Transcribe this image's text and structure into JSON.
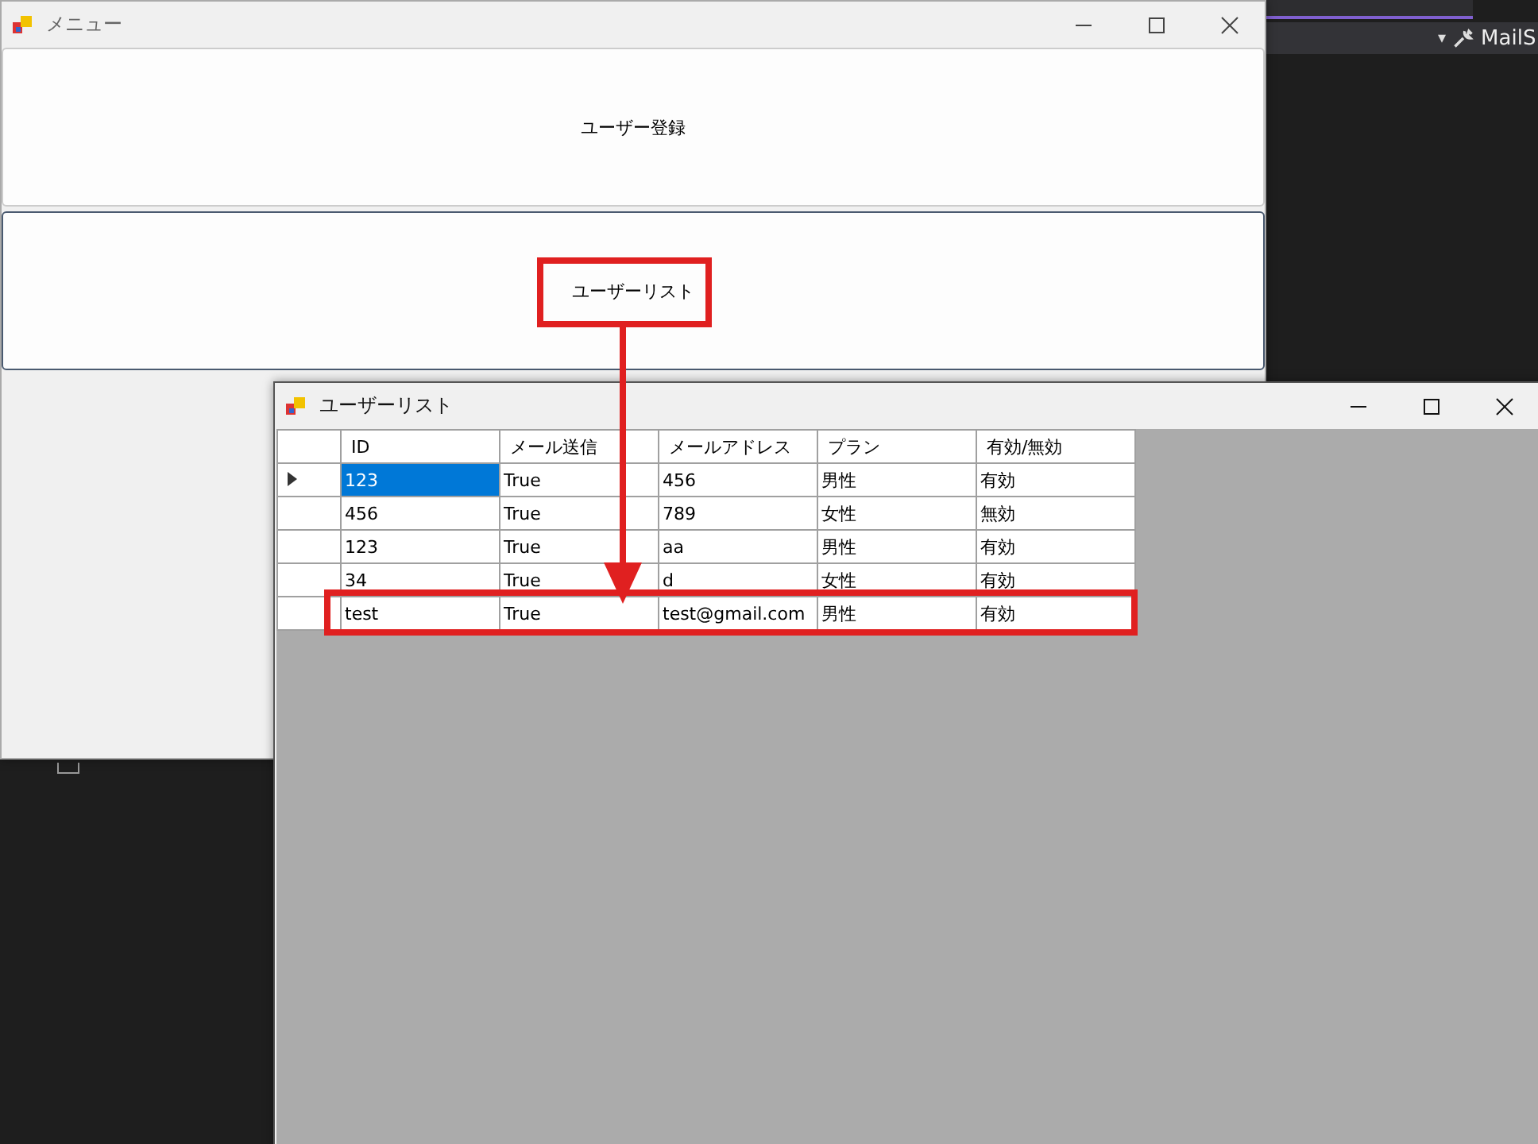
{
  "ide": {
    "dropdown": "▾",
    "toolbar_item": "MailS"
  },
  "menu_window": {
    "title": "メニュー",
    "buttons": [
      {
        "label": "ユーザー登録",
        "focused": false
      },
      {
        "label": "ユーザーリスト",
        "focused": true
      }
    ]
  },
  "list_window": {
    "title": "ユーザーリスト",
    "table": {
      "columns": [
        "ID",
        "メール送信",
        "メールアドレス",
        "プラン",
        "有効/無効"
      ],
      "rows": [
        {
          "selected": true,
          "cells": [
            "123",
            "True",
            "456",
            "男性",
            "有効"
          ]
        },
        {
          "selected": false,
          "cells": [
            "456",
            "True",
            "789",
            "女性",
            "無効"
          ]
        },
        {
          "selected": false,
          "cells": [
            "123",
            "True",
            "aa",
            "男性",
            "有効"
          ]
        },
        {
          "selected": false,
          "cells": [
            "34",
            "True",
            "d",
            "女性",
            "有効"
          ]
        },
        {
          "selected": false,
          "cells": [
            "test",
            "True",
            "test@gmail.com",
            "男性",
            "有効"
          ]
        }
      ]
    }
  }
}
